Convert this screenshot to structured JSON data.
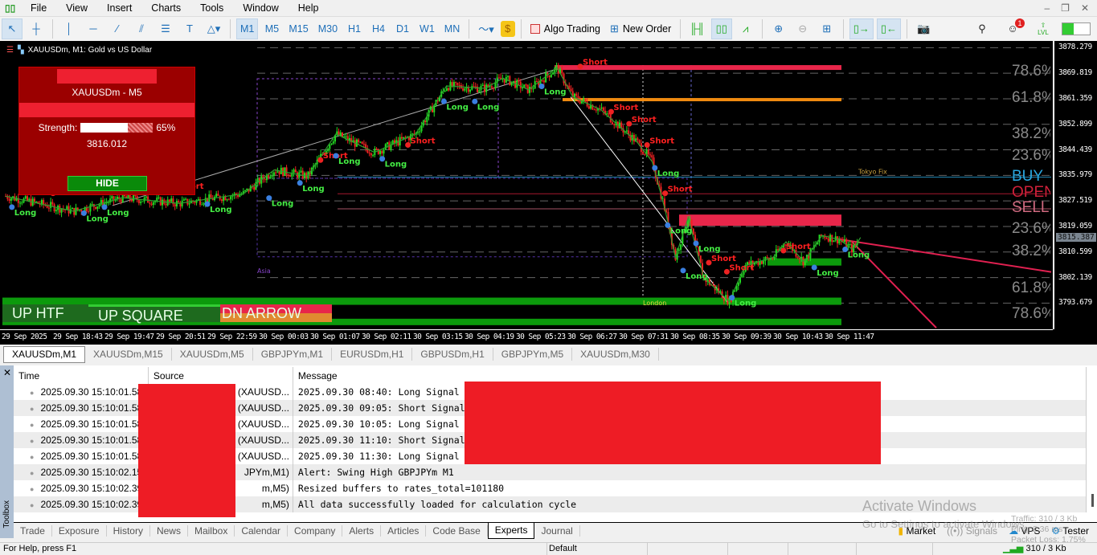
{
  "menu": {
    "items": [
      "File",
      "View",
      "Insert",
      "Charts",
      "Tools",
      "Window",
      "Help"
    ]
  },
  "toolbar": {
    "timeframes": [
      "M1",
      "M5",
      "M15",
      "M30",
      "H1",
      "H4",
      "D1",
      "W1",
      "MN"
    ],
    "selected_timeframe": "M1",
    "algo_trading": "Algo Trading",
    "new_order": "New Order",
    "notification_count": "1",
    "lvl": "LVL"
  },
  "chart": {
    "title": "XAUUSDm, M1:  Gold vs US Dollar",
    "panel": {
      "title": "XAUUSDm - M5",
      "strength_label": "Strength:",
      "strength_pct": 65,
      "strength_text": "65%",
      "price": "3816.012",
      "hide_label": "HIDE"
    },
    "price_range": [
      3785,
      3880.5
    ],
    "price_ticks": [
      "3878.279",
      "3869.819",
      "3861.359",
      "3852.899",
      "3844.439",
      "3835.979",
      "3827.519",
      "3819.059",
      "3810.599",
      "3802.139",
      "3793.679"
    ],
    "current_price": "3815.387",
    "time_ticks": [
      "29 Sep 2025",
      "29 Sep 18:43",
      "29 Sep 19:47",
      "29 Sep 20:51",
      "29 Sep 22:59",
      "30 Sep 00:03",
      "30 Sep 01:07",
      "30 Sep 02:11",
      "30 Sep 03:15",
      "30 Sep 04:19",
      "30 Sep 05:23",
      "30 Sep 06:27",
      "30 Sep 07:31",
      "30 Sep 08:35",
      "30 Sep 09:39",
      "30 Sep 10:43",
      "30 Sep 11:47"
    ],
    "price_path": [
      [
        0.08,
        3829.1
      ],
      [
        1.4,
        3824.1
      ],
      [
        2.35,
        3828.6
      ],
      [
        3.45,
        3826.7
      ],
      [
        4.7,
        3829.9
      ],
      [
        5.3,
        3837.8
      ],
      [
        5.95,
        3835.7
      ],
      [
        6.5,
        3849.7
      ],
      [
        7.25,
        3843.6
      ],
      [
        8.05,
        3849.7
      ],
      [
        8.65,
        3865.6
      ],
      [
        9.4,
        3864.8
      ],
      [
        9.75,
        3868.2
      ],
      [
        10.25,
        3864.3
      ],
      [
        10.8,
        3871.7
      ],
      [
        11.1,
        3862.1
      ],
      [
        11.65,
        3857.7
      ],
      [
        12.35,
        3847.1
      ],
      [
        12.65,
        3840.5
      ],
      [
        12.9,
        3824.6
      ],
      [
        13.1,
        3808.8
      ],
      [
        13.35,
        3822.0
      ],
      [
        13.65,
        3802.1
      ],
      [
        14.15,
        3794.2
      ],
      [
        14.45,
        3806.1
      ],
      [
        15.0,
        3808.8
      ],
      [
        15.25,
        3814.0
      ],
      [
        15.6,
        3807.4
      ],
      [
        15.95,
        3816.1
      ],
      [
        16.3,
        3814.6
      ],
      [
        16.55,
        3811.4
      ],
      [
        16.7,
        3815.4
      ]
    ],
    "fib_levels": [
      {
        "label": "78.6%",
        "price": 3870.1
      },
      {
        "label": "61.8%",
        "price": 3861.4
      },
      {
        "label": "38.2%",
        "price": 3849.5
      },
      {
        "label": "23.6%",
        "price": 3842.3
      },
      {
        "label": "23.6%",
        "price": 3818.0
      },
      {
        "label": "38.2%",
        "price": 3810.6
      },
      {
        "label": "61.8%",
        "price": 3798.4
      },
      {
        "label": "78.6%",
        "price": 3789.7
      }
    ],
    "trade_levels": [
      {
        "label": "BUY",
        "price": 3835.4,
        "color": "#2aa8e0"
      },
      {
        "label": "OPEN",
        "price": 3829.9,
        "color": "#d0203a"
      },
      {
        "label": "SELL",
        "price": 3824.9,
        "color": "#d06a80"
      }
    ],
    "session_labels": [
      "Tokyo Fix",
      "London",
      "Asia"
    ],
    "signals": [
      {
        "t": 0.2,
        "p": 3826,
        "s": "Long"
      },
      {
        "t": 1.0,
        "p": 3829,
        "s": "Short"
      },
      {
        "t": 1.6,
        "p": 3824,
        "s": "Long"
      },
      {
        "t": 2.0,
        "p": 3826,
        "s": "Long"
      },
      {
        "t": 3.4,
        "p": 3830,
        "s": "Short"
      },
      {
        "t": 4.0,
        "p": 3827,
        "s": "Long"
      },
      {
        "t": 5.2,
        "p": 3829,
        "s": "Long"
      },
      {
        "t": 5.8,
        "p": 3834,
        "s": "Long"
      },
      {
        "t": 6.2,
        "p": 3840,
        "s": "Short"
      },
      {
        "t": 6.5,
        "p": 3843,
        "s": "Long"
      },
      {
        "t": 7.4,
        "p": 3842,
        "s": "Long"
      },
      {
        "t": 7.9,
        "p": 3845,
        "s": "Short"
      },
      {
        "t": 8.6,
        "p": 3861,
        "s": "Long"
      },
      {
        "t": 9.2,
        "p": 3861,
        "s": "Long"
      },
      {
        "t": 10.5,
        "p": 3866,
        "s": "Long"
      },
      {
        "t": 11.25,
        "p": 3871,
        "s": "Short"
      },
      {
        "t": 11.85,
        "p": 3856,
        "s": "Short"
      },
      {
        "t": 12.2,
        "p": 3852,
        "s": "Short"
      },
      {
        "t": 12.55,
        "p": 3845,
        "s": "Short"
      },
      {
        "t": 12.7,
        "p": 3839,
        "s": "Long"
      },
      {
        "t": 12.9,
        "p": 3829,
        "s": "Short"
      },
      {
        "t": 12.95,
        "p": 3820,
        "s": "Long"
      },
      {
        "t": 13.5,
        "p": 3814,
        "s": "Long"
      },
      {
        "t": 13.25,
        "p": 3805,
        "s": "Long"
      },
      {
        "t": 13.75,
        "p": 3806,
        "s": "Short"
      },
      {
        "t": 14.1,
        "p": 3803,
        "s": "Short"
      },
      {
        "t": 14.2,
        "p": 3796,
        "s": "Long"
      },
      {
        "t": 15.2,
        "p": 3810,
        "s": "Short"
      },
      {
        "t": 15.8,
        "p": 3806,
        "s": "Long"
      },
      {
        "t": 16.4,
        "p": 3812,
        "s": "Long"
      }
    ],
    "bands": {
      "up_htf": "UP HTF",
      "up_square": "UP SQUARE",
      "dn_arrow": "DN ARROW"
    },
    "colors": {
      "bull": "#22dd22",
      "bear": "#ee2222",
      "zone_red": "#e8264a",
      "zone_orange": "#f08a10",
      "zone_green": "#0c9a0c"
    }
  },
  "chart_tabs": [
    "XAUUSDm,M1",
    "XAUUSDm,M15",
    "XAUUSDm,M5",
    "GBPJPYm,M1",
    "EURUSDm,H1",
    "GBPUSDm,H1",
    "GBPJPYm,M5",
    "XAUUSDm,M30"
  ],
  "toolbox": {
    "label": "Toolbox",
    "columns": [
      "Time",
      "Source",
      "Message"
    ],
    "rows": [
      {
        "time": "2025.09.30 15:10:01.581",
        "source": "(XAUUSD...",
        "message": "2025.09.30 08:40: Long Signal |"
      },
      {
        "time": "2025.09.30 15:10:01.581",
        "source": "(XAUUSD...",
        "message": "2025.09.30 09:05: Short Signal"
      },
      {
        "time": "2025.09.30 15:10:01.581",
        "source": "(XAUUSD...",
        "message": "2025.09.30 10:05: Long Signal |"
      },
      {
        "time": "2025.09.30 15:10:01.581",
        "source": "(XAUUSD...",
        "message": "2025.09.30 11:10: Short Signal"
      },
      {
        "time": "2025.09.30 15:10:01.581",
        "source": "(XAUUSD...",
        "message": "2025.09.30 11:30: Long Signal |"
      },
      {
        "time": "2025.09.30 15:10:02.150",
        "source": "JPYm,M1)",
        "message": "Alert: Swing High GBPJPYm M1"
      },
      {
        "time": "2025.09.30 15:10:02.394",
        "source": "m,M5)",
        "message": "Resized buffers to rates_total=101180"
      },
      {
        "time": "2025.09.30 15:10:02.394",
        "source": "m,M5)",
        "message": "All data successfully loaded for calculation cycle"
      }
    ],
    "tabs": [
      "Trade",
      "Exposure",
      "History",
      "News",
      "Mailbox",
      "Calendar",
      "Company",
      "Alerts",
      "Articles",
      "Code Base",
      "Experts",
      "Journal"
    ],
    "active_tab": "Experts",
    "right": [
      "Market",
      "Signals",
      "VPS",
      "Tester"
    ]
  },
  "status": {
    "help": "For Help, press F1",
    "profile": "Default",
    "traffic": "310 / 3 Kb",
    "tooltip": [
      "Traffic: 310 / 3 Kb",
      "Ping: 2.36 ms",
      "Packet Loss: 1.75%"
    ]
  },
  "watermark": {
    "title": "Activate Windows",
    "sub": "Go to Settings to activate Windows."
  }
}
